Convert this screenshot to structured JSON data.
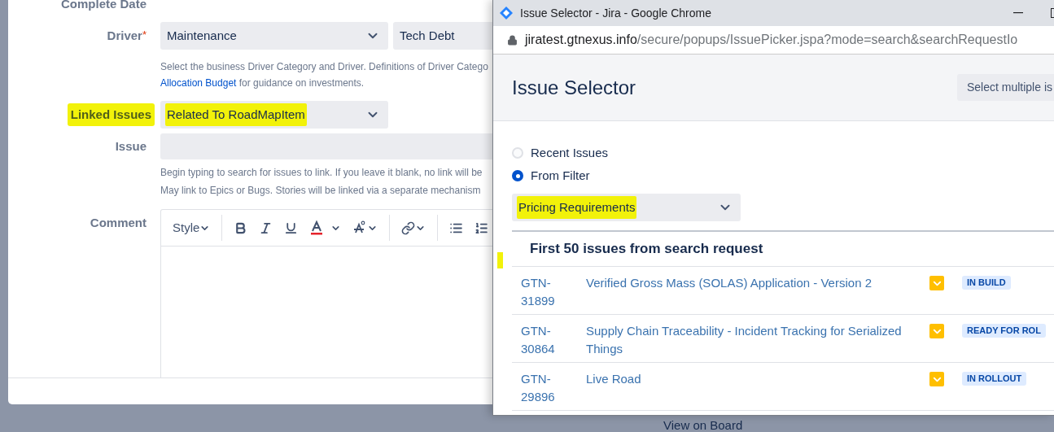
{
  "form": {
    "complete_date": {
      "label": "Complete Date"
    },
    "driver": {
      "label": "Driver",
      "required_mark": "*",
      "category": "Maintenance",
      "value": "Tech Debt",
      "help": "Select the business Driver Category and Driver. Definitions of Driver Catego",
      "help_link": "Allocation Budget",
      "help_rest": " for guidance on investments."
    },
    "linked_issues": {
      "label": "Linked Issues",
      "value": "Related To RoadMapItem",
      "highlighted": true
    },
    "issue": {
      "label": "Issue",
      "help": [
        "Begin typing to search for issues to link. If you leave it blank, no link will be",
        "May link to Epics or Bugs. Stories will be linked via a separate mechanism"
      ]
    },
    "comment": {
      "label": "Comment",
      "style_menu": "Style"
    }
  },
  "background_link": "View on Board",
  "popup": {
    "window_title": "Issue Selector - Jira - Google Chrome",
    "url_host": "jiratest.gtnexus.info",
    "url_path": "/secure/popups/IssuePicker.jspa?mode=search&searchRequestIo",
    "heading": "Issue Selector",
    "multi_button": "Select multiple is",
    "sources": [
      {
        "label": "Recent Issues",
        "selected": false
      },
      {
        "label": "From Filter",
        "selected": true
      }
    ],
    "filter": {
      "value": "Pricing Requirements",
      "highlighted": true
    },
    "results_heading": "First 50 issues from search request",
    "issues": [
      {
        "key": "GTN-31899",
        "summary": "Verified Gross Mass (SOLAS) Application - Version 2",
        "status": "IN BUILD"
      },
      {
        "key": "GTN-30864",
        "summary": "Supply Chain Traceability - Incident Tracking for Serialized Things",
        "status": "READY FOR ROL"
      },
      {
        "key": "GTN-29896",
        "summary": "Live Road",
        "status": "IN ROLLOUT"
      }
    ]
  }
}
